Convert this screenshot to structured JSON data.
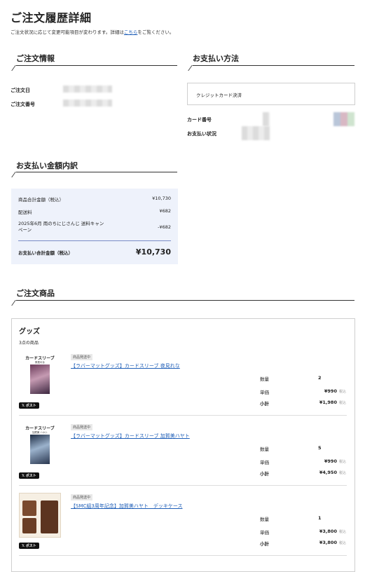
{
  "page": {
    "title": "ご注文履歴詳細",
    "note_prefix": "ご注文状況に応じて変更可能項目が変わります。詳細は",
    "note_link": "こちら",
    "note_suffix": "をご覧ください。"
  },
  "order_info": {
    "title": "ご注文情報",
    "date_label": "ご注文日",
    "number_label": "ご注文番号"
  },
  "payment_method": {
    "title": "お支払い方法",
    "method": "クレジットカード決済",
    "card_label": "カード番号",
    "status_label": "お支払い状況"
  },
  "summary": {
    "title": "お支払い金額内訳",
    "rows": [
      {
        "label": "商品合計金額（税込）",
        "value": "¥10,730"
      },
      {
        "label": "配送料",
        "value": "¥682"
      },
      {
        "label": "2025年6月 雨のちにじさんじ 送料キャンペーン",
        "value": "-¥682"
      }
    ],
    "total_label": "お支払い合計金額（税込）",
    "total_value": "¥10,730"
  },
  "products": {
    "title": "ご注文商品",
    "category": "グッズ",
    "count": "3点の商品",
    "qty_label": "数量",
    "price_label": "単価",
    "subtotal_label": "小計",
    "tax_label": "税込",
    "post_label": "ポスト",
    "items": [
      {
        "badge": "商品発送中",
        "name": "【ラバーマットグッズ】カードスリーブ 夜見れな",
        "thumb_title": "カードスリーブ",
        "thumb_sub": "夜見れな",
        "qty": "2",
        "price": "¥990",
        "subtotal": "¥1,980"
      },
      {
        "badge": "商品発送中",
        "name": "【ラバーマットグッズ】カードスリーブ 加賀美ハヤト",
        "thumb_title": "カードスリーブ",
        "thumb_sub": "加賀美 ハヤト",
        "qty": "5",
        "price": "¥990",
        "subtotal": "¥4,950"
      },
      {
        "badge": "商品発送中",
        "name": "【SMC組3周年記念】加賀美ハヤト　デッキケース",
        "thumb_title": "",
        "thumb_sub": "",
        "qty": "1",
        "price": "¥3,800",
        "subtotal": "¥3,800"
      }
    ]
  }
}
